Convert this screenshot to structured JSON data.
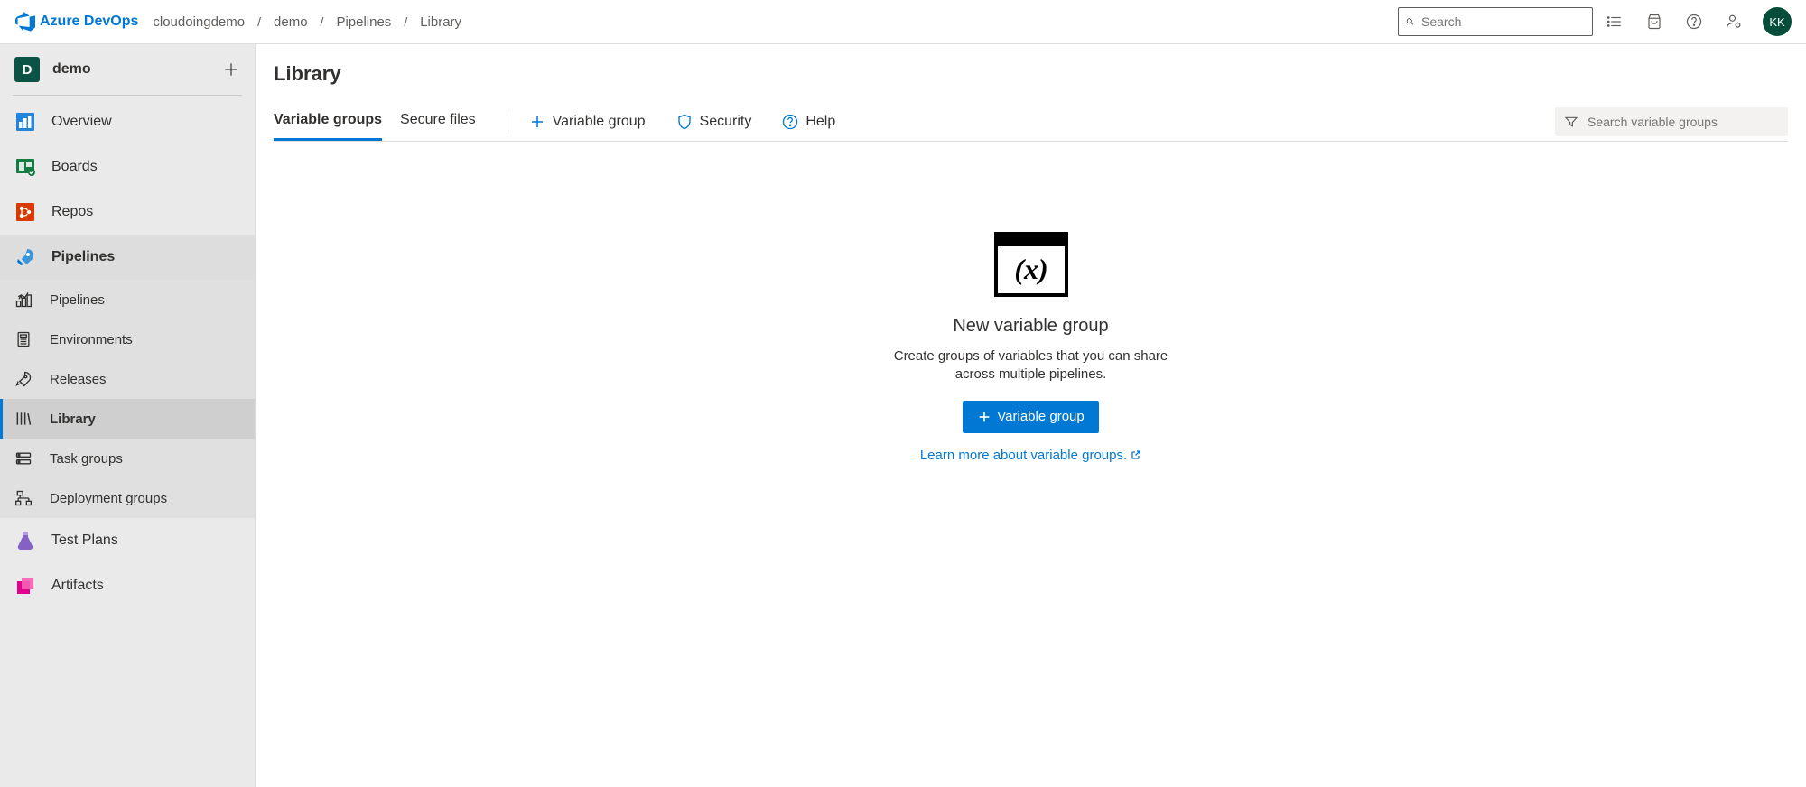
{
  "header": {
    "brand": "Azure DevOps",
    "breadcrumbs": [
      "cloudoingdemo",
      "demo",
      "Pipelines",
      "Library"
    ],
    "search_placeholder": "Search",
    "avatar_initials": "KK"
  },
  "sidebar": {
    "project_initial": "D",
    "project_name": "demo",
    "nav": [
      {
        "label": "Overview"
      },
      {
        "label": "Boards"
      },
      {
        "label": "Repos"
      },
      {
        "label": "Pipelines",
        "active": true
      },
      {
        "label": "Test Plans"
      },
      {
        "label": "Artifacts"
      }
    ],
    "subnav": [
      {
        "label": "Pipelines"
      },
      {
        "label": "Environments"
      },
      {
        "label": "Releases"
      },
      {
        "label": "Library",
        "selected": true
      },
      {
        "label": "Task groups"
      },
      {
        "label": "Deployment groups"
      }
    ]
  },
  "main": {
    "title": "Library",
    "tabs": [
      {
        "label": "Variable groups",
        "active": true
      },
      {
        "label": "Secure files"
      }
    ],
    "actions": {
      "new_group": "Variable group",
      "security": "Security",
      "help": "Help"
    },
    "filter_placeholder": "Search variable groups",
    "empty": {
      "title": "New variable group",
      "desc": "Create groups of variables that you can share across multiple pipelines.",
      "button": "Variable group",
      "link": "Learn more about variable groups."
    }
  }
}
